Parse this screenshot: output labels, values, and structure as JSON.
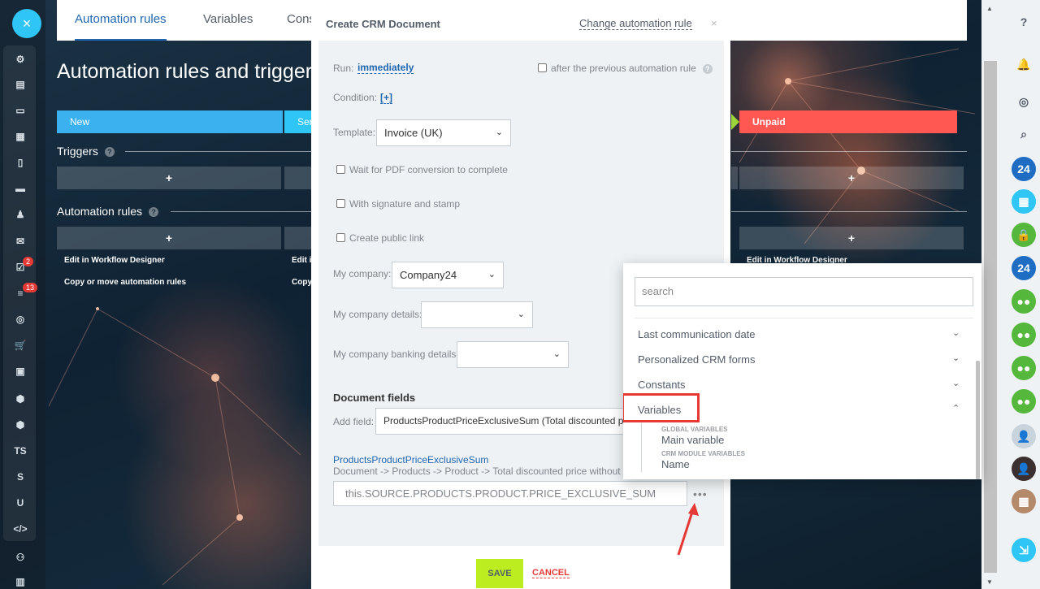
{
  "tabs": [
    "Automation rules",
    "Variables",
    "Cons"
  ],
  "page_title": "Automation rules and triggers",
  "stages": [
    {
      "label": "New",
      "color": "#3bb1f0"
    },
    {
      "label": "Ser",
      "color": "#2fc6f6"
    },
    {
      "label": "Unpaid",
      "color": "#ff5752"
    }
  ],
  "sections": {
    "triggers": "Triggers",
    "automation_rules": "Automation rules",
    "add": "+",
    "edit_link": "Edit in Workflow Designer",
    "edit_link_short": "Edit i",
    "copy_link": "Copy or move automation rules",
    "copy_link_short": "Copy",
    "edit_link_right": "Edit in Workflow Designer"
  },
  "left_sidebar": {
    "logo": "×",
    "badges": [
      "2",
      "13"
    ],
    "icons": [
      "pulse-icon",
      "news-icon",
      "chat-icon",
      "calendar-icon",
      "document-icon",
      "drive-icon",
      "contacts-icon",
      "mail-icon",
      "tasks-icon",
      "crm-icon",
      "target-icon",
      "cart-icon",
      "id-card-icon",
      "box-icon",
      "box2-icon",
      "text-icon",
      "text-icon",
      "text-icon",
      "code-icon",
      "robot-icon",
      "grid-icon"
    ],
    "texts": [
      "TS",
      "S",
      "U",
      "</>"
    ]
  },
  "right_sidebar": {
    "items": [
      {
        "icon": "help-icon",
        "label": "?",
        "color": "#535c69"
      },
      {
        "icon": "bell-icon",
        "label": "🔔",
        "color": "#535c69"
      },
      {
        "icon": "chat-search-icon",
        "label": "◎",
        "color": "#535c69"
      },
      {
        "icon": "search-icon",
        "label": "⌕",
        "color": "#535c69"
      },
      {
        "icon": "b24-icon",
        "label": "24",
        "color": "#1e6dc2"
      },
      {
        "icon": "calendar-icon",
        "label": "▦",
        "color": "#2fc6f6"
      },
      {
        "icon": "lock-icon",
        "label": "🔒",
        "color": "#55b83d"
      },
      {
        "icon": "b24-icon",
        "label": "24",
        "color": "#1e6dc2"
      },
      {
        "icon": "group-icon",
        "label": "●●",
        "color": "#55b83d"
      },
      {
        "icon": "group-icon",
        "label": "●●",
        "color": "#55b83d"
      },
      {
        "icon": "group-icon",
        "label": "●●",
        "color": "#55b83d"
      },
      {
        "icon": "group-icon",
        "label": "●●",
        "color": "#55b83d"
      },
      {
        "icon": "avatar-icon",
        "label": "👤",
        "color": "#c9d3dc"
      },
      {
        "icon": "avatar-icon",
        "label": "👤",
        "color": "#3c2f2f"
      },
      {
        "icon": "calendar-icon",
        "label": "▦",
        "color": "#b58a6b"
      },
      {
        "icon": "call-icon",
        "label": "⇲",
        "color": "#2fc6f6"
      }
    ]
  },
  "modal": {
    "title": "Create CRM Document",
    "change_link": "Change automation rule",
    "close": "×",
    "run_label": "Run:",
    "run_value": "immediately",
    "after_prev": "after the previous automation rule",
    "condition_label": "Condition:",
    "condition_value": "[+]",
    "template_label": "Template:",
    "template_value": "Invoice (UK)",
    "checkbox_pdf": "Wait for PDF conversion to complete",
    "checkbox_signature": "With signature and stamp",
    "checkbox_public": "Create public link",
    "my_company_label": "My company:",
    "my_company_value": "Company24",
    "my_company_details_label": "My company details:",
    "my_company_details_value": "",
    "my_company_banking_label": "My company banking details:",
    "my_company_banking_value": "",
    "document_fields": "Document fields",
    "add_field_label": "Add field:",
    "add_field_value": "ProductsProductPriceExclusiveSum (Total discounted pric",
    "field_name": "ProductsProductPriceExclusiveSum",
    "field_path": "Document -> Products -> Product -> Total discounted price without tax",
    "expression": "this.SOURCE.PRODUCTS.PRODUCT.PRICE_EXCLUSIVE_SUM",
    "dots": "•••",
    "save": "SAVE",
    "cancel": "CANCEL"
  },
  "popup": {
    "search_placeholder": "search",
    "rows": [
      "Last communication date",
      "Personalized CRM forms",
      "Constants",
      "Variables"
    ],
    "group_global": "GLOBAL VARIABLES",
    "item_global": "Main variable",
    "group_crm": "CRM MODULE VARIABLES",
    "item_crm": "Name"
  },
  "colors": {
    "accent": "#2067b0",
    "save_button": "#bbed21",
    "highlight": "#e53935"
  }
}
